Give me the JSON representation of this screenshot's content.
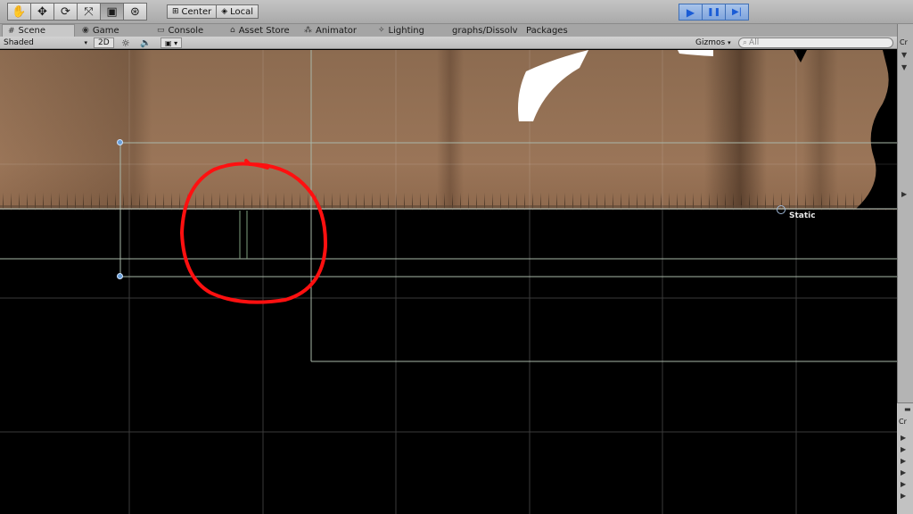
{
  "toolbar": {
    "tools": [
      {
        "name": "hand-tool",
        "icon": "hand-icon",
        "glyph": "✋"
      },
      {
        "name": "move-tool",
        "icon": "move-icon",
        "glyph": "✥"
      },
      {
        "name": "rotate-tool",
        "icon": "rotate-icon",
        "glyph": "⟳"
      },
      {
        "name": "scale-tool",
        "icon": "scale-icon",
        "glyph": "⤧"
      },
      {
        "name": "rect-tool",
        "icon": "rect-icon",
        "glyph": "▣"
      },
      {
        "name": "transform-tool",
        "icon": "transform-icon",
        "glyph": "⊛"
      }
    ],
    "pivot_label": "Center",
    "space_label": "Local",
    "play_controls": [
      {
        "name": "play-button",
        "icon": "play-icon",
        "glyph": "▶"
      },
      {
        "name": "pause-button",
        "icon": "pause-icon",
        "glyph": "❚❚"
      },
      {
        "name": "step-button",
        "icon": "step-icon",
        "glyph": "▶|"
      }
    ]
  },
  "tabs": {
    "scene": "Scene",
    "game": "Game",
    "console": "Console",
    "asset_store": "Asset Store",
    "animator": "Animator",
    "lighting": "Lighting",
    "shadergraph": "graphs/Dissolv",
    "packages": "Packages"
  },
  "scenebar": {
    "draw_mode": "Shaded",
    "mode_2d": "2D",
    "gizmos": "Gizmos",
    "search_placeholder": "All"
  },
  "scene": {
    "static_label": "Static"
  },
  "rightpanel": {
    "top_tab": "Cr",
    "bottom_tab": "Cr"
  },
  "colors": {
    "annotation_red": "#ff1010",
    "ground_brown": "#8c6b50",
    "play_blue": "#1a5cd6"
  }
}
